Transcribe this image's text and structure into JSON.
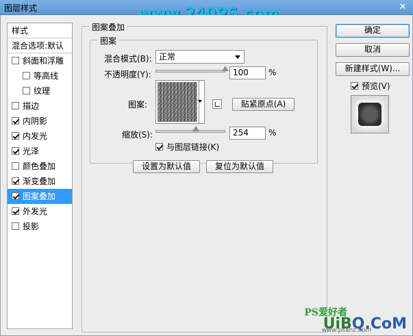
{
  "window": {
    "title": "图层样式",
    "watermark_top": "www.240PS.com"
  },
  "stylelist": {
    "header": "样式",
    "blend": "混合选项:默认",
    "items": [
      {
        "label": "斜面和浮雕",
        "checked": false
      },
      {
        "label": "等高线",
        "checked": false,
        "sub": true
      },
      {
        "label": "纹理",
        "checked": false,
        "sub": true
      },
      {
        "label": "描边",
        "checked": false
      },
      {
        "label": "内阴影",
        "checked": true
      },
      {
        "label": "内发光",
        "checked": true
      },
      {
        "label": "光泽",
        "checked": true
      },
      {
        "label": "颜色叠加",
        "checked": false
      },
      {
        "label": "渐变叠加",
        "checked": true
      },
      {
        "label": "图案叠加",
        "checked": true,
        "selected": true
      },
      {
        "label": "外发光",
        "checked": true
      },
      {
        "label": "投影",
        "checked": false
      }
    ]
  },
  "panel": {
    "outer_legend": "图案叠加",
    "inner_legend": "图案",
    "blend_mode_label": "混合模式(B):",
    "blend_mode_value": "正常",
    "opacity_label": "不透明度(Y):",
    "opacity_value": "100",
    "opacity_fraction": 1.0,
    "percent": "%",
    "pattern_label": "图案:",
    "snap_button": "贴紧原点(A)",
    "scale_label": "缩放(S):",
    "scale_value": "254",
    "link_label": "与图层链接(K)",
    "link_checked": true,
    "set_default_button": "设置为默认值",
    "reset_default_button": "复位为默认值"
  },
  "right": {
    "ok_button": "确定",
    "cancel_button": "取消",
    "new_style_button": "新建样式(W)...",
    "preview_label": "预览(V)",
    "preview_checked": true
  },
  "watermark_bottom": {
    "main_a": "UiB",
    "main_b": "Q.CoM",
    "ps": "PS爱好者",
    "sub": "www.psahz.com"
  }
}
